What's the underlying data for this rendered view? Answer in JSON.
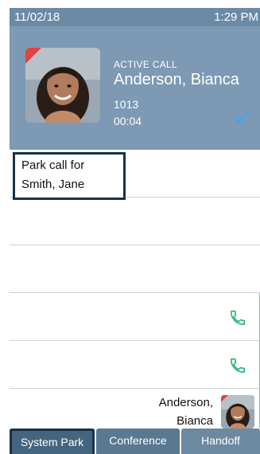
{
  "status_bar": {
    "date": "11/02/18",
    "time": "1:29 PM"
  },
  "active_call": {
    "state": "ACTIVE CALL",
    "name": "Anderson, Bianca",
    "extension": "1013",
    "duration": "00:04",
    "direction_icon": "incoming-call-arrow-icon"
  },
  "park_prompt": {
    "title": "Park call for",
    "target": "Smith, Jane"
  },
  "rows": [
    {
      "label": "",
      "icon": ""
    },
    {
      "label": "",
      "icon": ""
    },
    {
      "label": "",
      "icon": "phone-icon"
    },
    {
      "label": "",
      "icon": "phone-icon"
    },
    {
      "label": "Anderson, Bianca",
      "icon": "avatar"
    }
  ],
  "softkeys": [
    "System Park",
    "Conference",
    "Handoff"
  ],
  "colors": {
    "status_bar": "#6b8aa3",
    "header": "#7d99b3",
    "softkey": "#45657f",
    "focus_border": "#18314a",
    "call_green": "#2bb673"
  }
}
